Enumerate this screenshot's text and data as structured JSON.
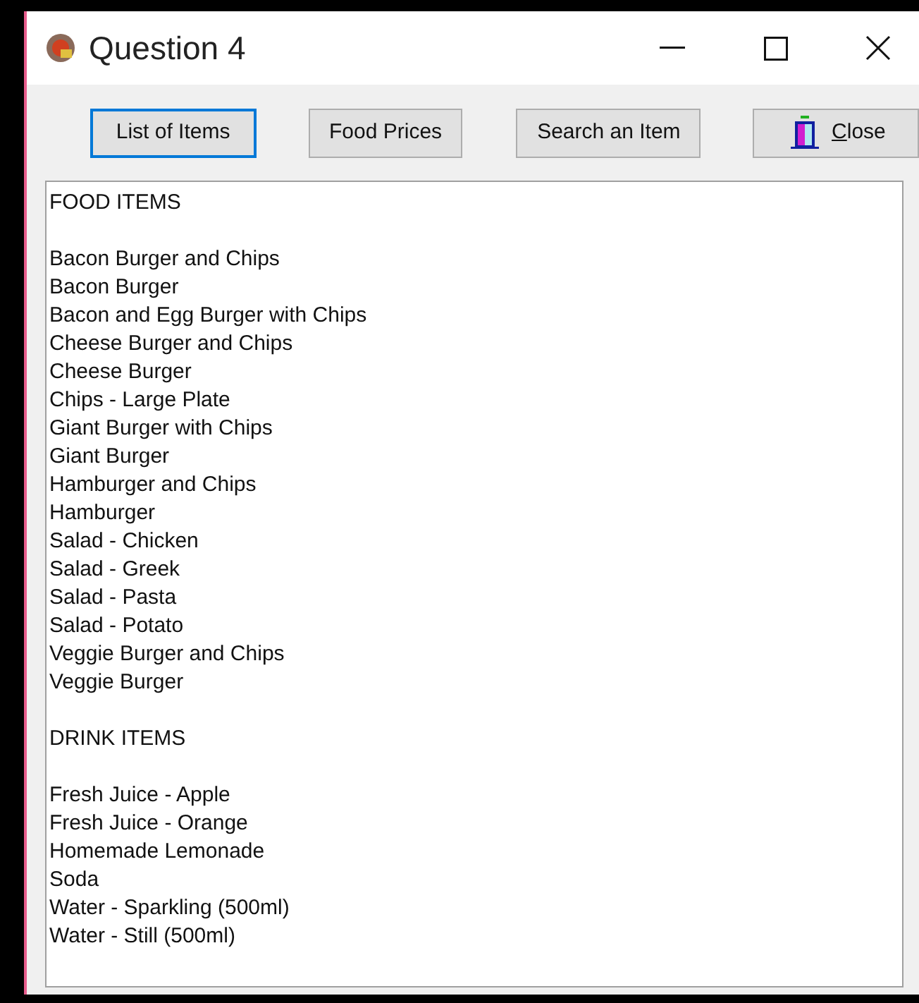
{
  "window": {
    "title": "Question 4"
  },
  "buttons": [
    {
      "label": "List of Items",
      "selected": true,
      "kind": "text"
    },
    {
      "label": "Food Prices",
      "selected": false,
      "kind": "text"
    },
    {
      "label": "Search an Item",
      "selected": false,
      "kind": "text"
    },
    {
      "label": "Close",
      "selected": false,
      "kind": "icon"
    }
  ],
  "list": [
    {
      "heading": "FOOD ITEMS",
      "items": [
        "Bacon Burger and Chips",
        "Bacon Burger",
        "Bacon and Egg Burger with Chips",
        "Cheese Burger and Chips",
        "Cheese Burger",
        "Chips - Large Plate",
        "Giant Burger with Chips",
        "Giant Burger",
        "Hamburger and Chips",
        "Hamburger",
        "Salad - Chicken",
        "Salad - Greek",
        "Salad - Pasta",
        "Salad - Potato",
        "Veggie Burger and Chips",
        "Veggie Burger"
      ]
    },
    {
      "heading": "DRINK ITEMS",
      "items": [
        "Fresh Juice - Apple",
        "Fresh Juice - Orange",
        "Homemade Lemonade",
        "Soda",
        "Water - Sparkling (500ml)",
        "Water - Still (500ml)"
      ]
    }
  ]
}
